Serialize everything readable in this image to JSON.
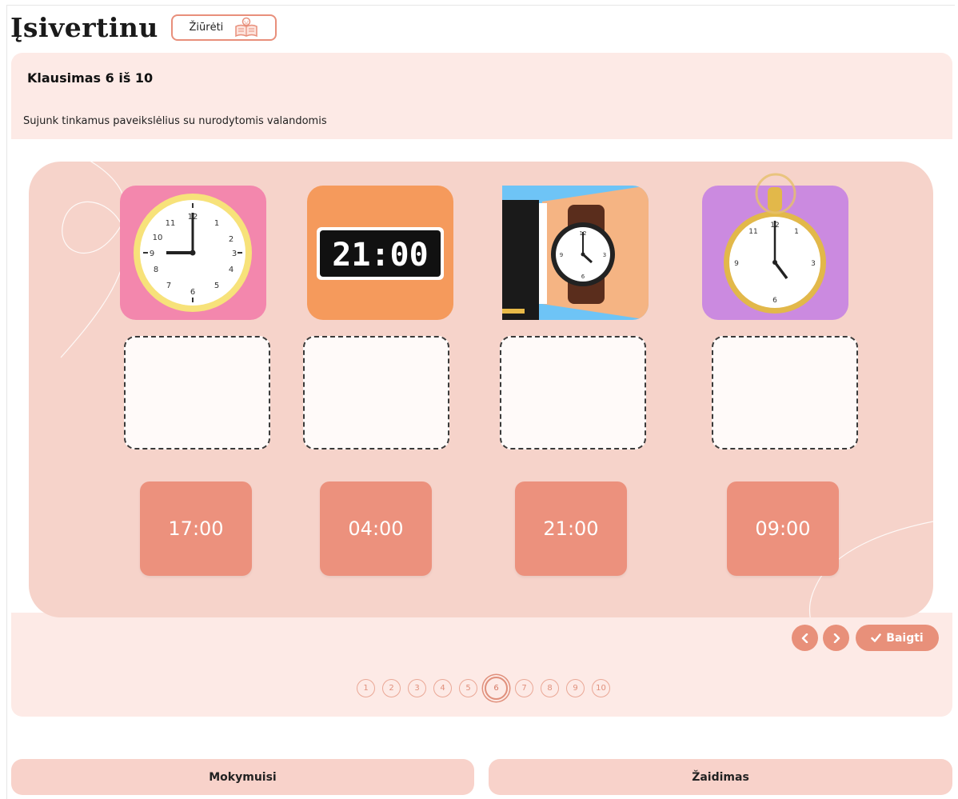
{
  "header": {
    "title": "Įsivertinu",
    "watch_label": "Žiūrėti",
    "watch_icon": "open-book-icon"
  },
  "question": {
    "counter": "Klausimas 6 iš 10",
    "instruction": "Sujunk tinkamus paveikslėlius su nurodytomis valandomis"
  },
  "pictures": [
    {
      "name": "wall-clock-icon",
      "bg": "#f387ad"
    },
    {
      "name": "digital-clock-icon",
      "bg": "#f59a5c",
      "display": "21:00"
    },
    {
      "name": "wristwatch-icon",
      "bg": "#6ec4f6"
    },
    {
      "name": "pocket-watch-icon",
      "bg": "#cb8ae0"
    }
  ],
  "time_options": [
    "17:00",
    "04:00",
    "21:00",
    "09:00"
  ],
  "nav": {
    "prev_icon": "chevron-left-icon",
    "next_icon": "chevron-right-icon",
    "finish_label": "Baigti",
    "finish_icon": "check-icon"
  },
  "pages": [
    "1",
    "2",
    "3",
    "4",
    "5",
    "6",
    "7",
    "8",
    "9",
    "10"
  ],
  "current_page": "6",
  "footer": {
    "learn_label": "Mokymuisi",
    "game_label": "Žaidimas"
  },
  "colors": {
    "accent": "#e8907a",
    "panel": "#fdeae6",
    "board": "#f6d3ca",
    "tile": "#ec917d"
  }
}
